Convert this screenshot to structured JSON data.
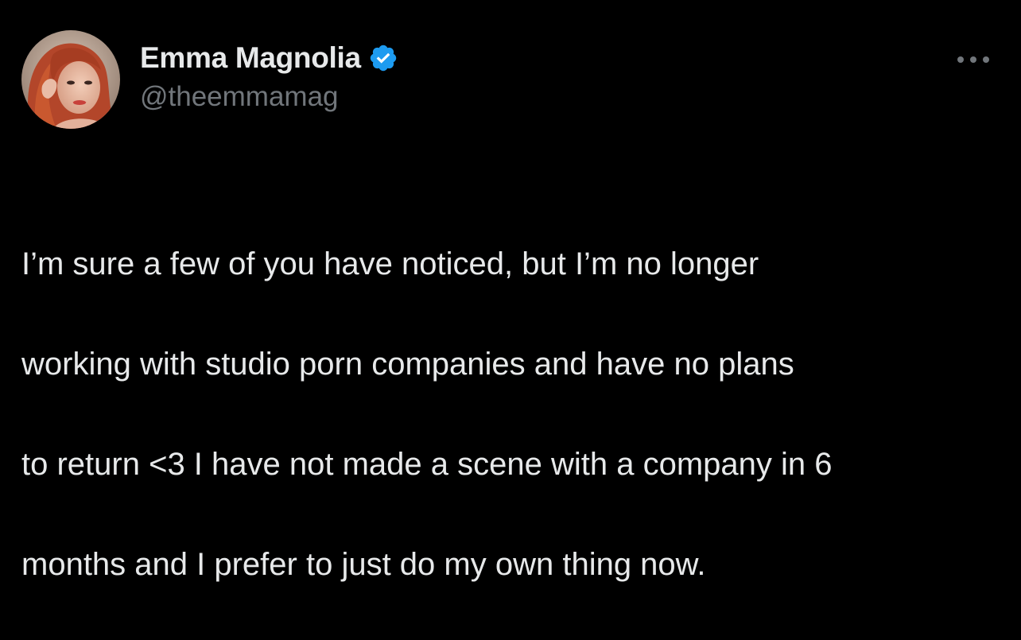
{
  "tweet": {
    "author": {
      "display_name": "Emma Magnolia",
      "handle": "@theemmamag",
      "verified": true,
      "verified_badge_color": "#1d9bf0",
      "avatar_icon": "profile-photo"
    },
    "more_icon": "ellipsis-icon",
    "text_lines": [
      "I’m sure a few of you have noticed, but I’m no longer",
      "working with studio porn companies and have no plans",
      "to return <3 I have not made a scene with a company in 6",
      "months and I prefer to just do my own thing now."
    ],
    "colors": {
      "background": "#000000",
      "primary_text": "#e7e9ea",
      "secondary_text": "#71767b"
    }
  }
}
